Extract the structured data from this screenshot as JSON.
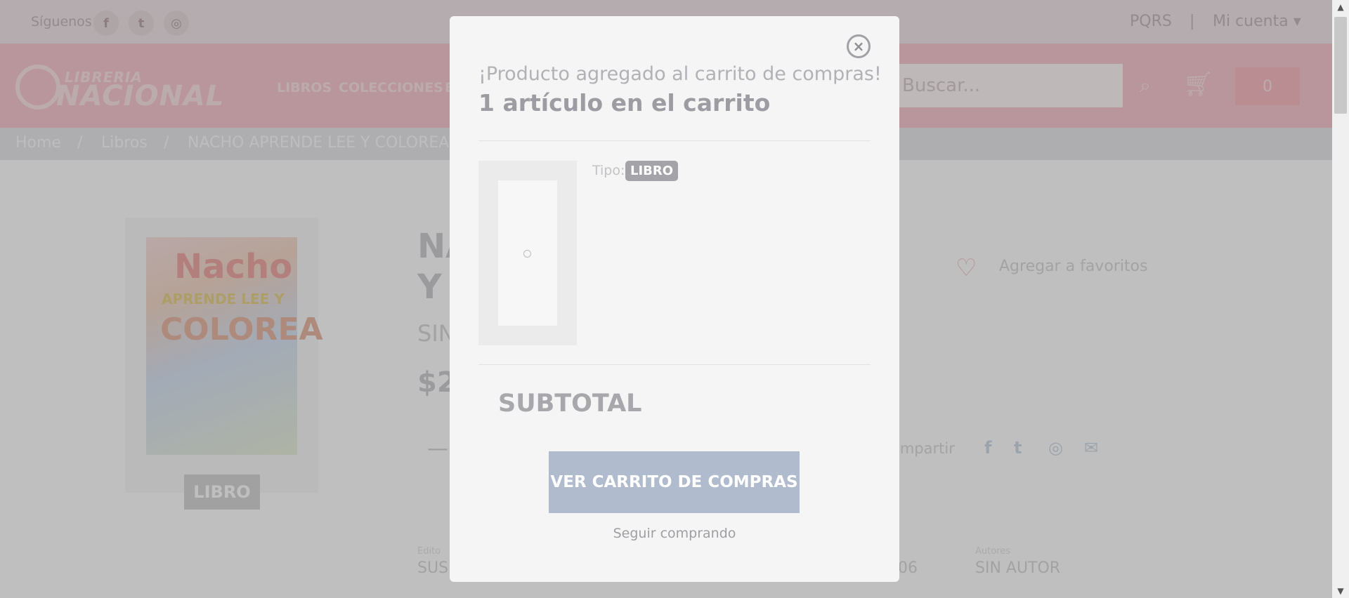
{
  "topbar": {
    "follow_label": "Síguenos",
    "social": [
      {
        "icon": "facebook-icon",
        "glyph": "f"
      },
      {
        "icon": "twitter-icon",
        "glyph": "t"
      },
      {
        "icon": "instagram-icon",
        "glyph": "◎"
      }
    ],
    "pqrs": "PQRS",
    "separator": "|",
    "account": "Mi cuenta ▾"
  },
  "header": {
    "logo_small": "LIBRERIA",
    "logo_big": "NACIONAL",
    "nav": [
      "LIBROS",
      "COLECCIONES",
      "E"
    ],
    "search_placeholder": "Buscar...",
    "cart_count": "0"
  },
  "breadcrumb": {
    "items": [
      "Home",
      "/",
      "Libros",
      "/",
      "NACHO APRENDE LEE Y COLOREA"
    ]
  },
  "product": {
    "cover_text": [
      "Nacho",
      "APRENDE LEE Y",
      "COLOREA"
    ],
    "type_badge": "LIBRO",
    "title_line1": "NA",
    "title_line2": "Y",
    "author_partial": "SIN",
    "price_partial": "$2",
    "qty_minus": "—",
    "favorite_label": "Agregar a favoritos",
    "share_label": "ompartir",
    "details": [
      {
        "label": "Edito",
        "value": "SUS"
      },
      {
        "label": "",
        "value": "06"
      },
      {
        "label": "Autores",
        "value": "SIN AUTOR"
      }
    ]
  },
  "modal": {
    "heading": "¡Producto agregado al carrito de compras!",
    "item_count_text": "1 artículo en el carrito",
    "type_label": "Tipo:",
    "type_value": "LIBRO",
    "subtotal_label": "SUBTOTAL",
    "view_cart_button": "VER CARRITO DE COMPRAS",
    "continue_link": "Seguir comprando",
    "close_glyph": "×"
  },
  "colors": {
    "brand_red": "#e2001a",
    "modal_bg": "#f5f5f5",
    "button_bg": "#b1bbce"
  }
}
